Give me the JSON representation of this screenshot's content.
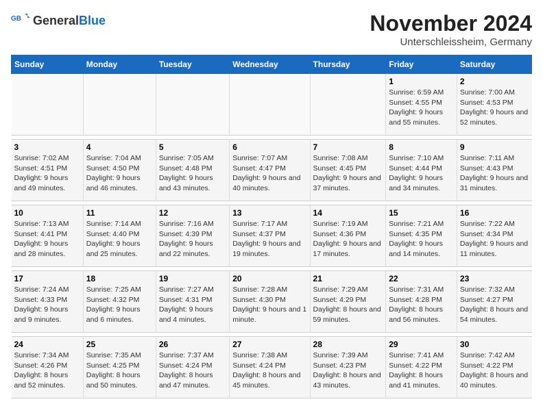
{
  "header": {
    "logo_general": "General",
    "logo_blue": "Blue",
    "title": "November 2024",
    "subtitle": "Unterschleissheim, Germany"
  },
  "weekdays": [
    "Sunday",
    "Monday",
    "Tuesday",
    "Wednesday",
    "Thursday",
    "Friday",
    "Saturday"
  ],
  "weeks": [
    {
      "days": [
        {
          "num": "",
          "sunrise": "",
          "sunset": "",
          "daylight": ""
        },
        {
          "num": "",
          "sunrise": "",
          "sunset": "",
          "daylight": ""
        },
        {
          "num": "",
          "sunrise": "",
          "sunset": "",
          "daylight": ""
        },
        {
          "num": "",
          "sunrise": "",
          "sunset": "",
          "daylight": ""
        },
        {
          "num": "",
          "sunrise": "",
          "sunset": "",
          "daylight": ""
        },
        {
          "num": "1",
          "sunrise": "Sunrise: 6:59 AM",
          "sunset": "Sunset: 4:55 PM",
          "daylight": "Daylight: 9 hours and 55 minutes."
        },
        {
          "num": "2",
          "sunrise": "Sunrise: 7:00 AM",
          "sunset": "Sunset: 4:53 PM",
          "daylight": "Daylight: 9 hours and 52 minutes."
        }
      ]
    },
    {
      "days": [
        {
          "num": "3",
          "sunrise": "Sunrise: 7:02 AM",
          "sunset": "Sunset: 4:51 PM",
          "daylight": "Daylight: 9 hours and 49 minutes."
        },
        {
          "num": "4",
          "sunrise": "Sunrise: 7:04 AM",
          "sunset": "Sunset: 4:50 PM",
          "daylight": "Daylight: 9 hours and 46 minutes."
        },
        {
          "num": "5",
          "sunrise": "Sunrise: 7:05 AM",
          "sunset": "Sunset: 4:48 PM",
          "daylight": "Daylight: 9 hours and 43 minutes."
        },
        {
          "num": "6",
          "sunrise": "Sunrise: 7:07 AM",
          "sunset": "Sunset: 4:47 PM",
          "daylight": "Daylight: 9 hours and 40 minutes."
        },
        {
          "num": "7",
          "sunrise": "Sunrise: 7:08 AM",
          "sunset": "Sunset: 4:45 PM",
          "daylight": "Daylight: 9 hours and 37 minutes."
        },
        {
          "num": "8",
          "sunrise": "Sunrise: 7:10 AM",
          "sunset": "Sunset: 4:44 PM",
          "daylight": "Daylight: 9 hours and 34 minutes."
        },
        {
          "num": "9",
          "sunrise": "Sunrise: 7:11 AM",
          "sunset": "Sunset: 4:43 PM",
          "daylight": "Daylight: 9 hours and 31 minutes."
        }
      ]
    },
    {
      "days": [
        {
          "num": "10",
          "sunrise": "Sunrise: 7:13 AM",
          "sunset": "Sunset: 4:41 PM",
          "daylight": "Daylight: 9 hours and 28 minutes."
        },
        {
          "num": "11",
          "sunrise": "Sunrise: 7:14 AM",
          "sunset": "Sunset: 4:40 PM",
          "daylight": "Daylight: 9 hours and 25 minutes."
        },
        {
          "num": "12",
          "sunrise": "Sunrise: 7:16 AM",
          "sunset": "Sunset: 4:39 PM",
          "daylight": "Daylight: 9 hours and 22 minutes."
        },
        {
          "num": "13",
          "sunrise": "Sunrise: 7:17 AM",
          "sunset": "Sunset: 4:37 PM",
          "daylight": "Daylight: 9 hours and 19 minutes."
        },
        {
          "num": "14",
          "sunrise": "Sunrise: 7:19 AM",
          "sunset": "Sunset: 4:36 PM",
          "daylight": "Daylight: 9 hours and 17 minutes."
        },
        {
          "num": "15",
          "sunrise": "Sunrise: 7:21 AM",
          "sunset": "Sunset: 4:35 PM",
          "daylight": "Daylight: 9 hours and 14 minutes."
        },
        {
          "num": "16",
          "sunrise": "Sunrise: 7:22 AM",
          "sunset": "Sunset: 4:34 PM",
          "daylight": "Daylight: 9 hours and 11 minutes."
        }
      ]
    },
    {
      "days": [
        {
          "num": "17",
          "sunrise": "Sunrise: 7:24 AM",
          "sunset": "Sunset: 4:33 PM",
          "daylight": "Daylight: 9 hours and 9 minutes."
        },
        {
          "num": "18",
          "sunrise": "Sunrise: 7:25 AM",
          "sunset": "Sunset: 4:32 PM",
          "daylight": "Daylight: 9 hours and 6 minutes."
        },
        {
          "num": "19",
          "sunrise": "Sunrise: 7:27 AM",
          "sunset": "Sunset: 4:31 PM",
          "daylight": "Daylight: 9 hours and 4 minutes."
        },
        {
          "num": "20",
          "sunrise": "Sunrise: 7:28 AM",
          "sunset": "Sunset: 4:30 PM",
          "daylight": "Daylight: 9 hours and 1 minute."
        },
        {
          "num": "21",
          "sunrise": "Sunrise: 7:29 AM",
          "sunset": "Sunset: 4:29 PM",
          "daylight": "Daylight: 8 hours and 59 minutes."
        },
        {
          "num": "22",
          "sunrise": "Sunrise: 7:31 AM",
          "sunset": "Sunset: 4:28 PM",
          "daylight": "Daylight: 8 hours and 56 minutes."
        },
        {
          "num": "23",
          "sunrise": "Sunrise: 7:32 AM",
          "sunset": "Sunset: 4:27 PM",
          "daylight": "Daylight: 8 hours and 54 minutes."
        }
      ]
    },
    {
      "days": [
        {
          "num": "24",
          "sunrise": "Sunrise: 7:34 AM",
          "sunset": "Sunset: 4:26 PM",
          "daylight": "Daylight: 8 hours and 52 minutes."
        },
        {
          "num": "25",
          "sunrise": "Sunrise: 7:35 AM",
          "sunset": "Sunset: 4:25 PM",
          "daylight": "Daylight: 8 hours and 50 minutes."
        },
        {
          "num": "26",
          "sunrise": "Sunrise: 7:37 AM",
          "sunset": "Sunset: 4:24 PM",
          "daylight": "Daylight: 8 hours and 47 minutes."
        },
        {
          "num": "27",
          "sunrise": "Sunrise: 7:38 AM",
          "sunset": "Sunset: 4:24 PM",
          "daylight": "Daylight: 8 hours and 45 minutes."
        },
        {
          "num": "28",
          "sunrise": "Sunrise: 7:39 AM",
          "sunset": "Sunset: 4:23 PM",
          "daylight": "Daylight: 8 hours and 43 minutes."
        },
        {
          "num": "29",
          "sunrise": "Sunrise: 7:41 AM",
          "sunset": "Sunset: 4:22 PM",
          "daylight": "Daylight: 8 hours and 41 minutes."
        },
        {
          "num": "30",
          "sunrise": "Sunrise: 7:42 AM",
          "sunset": "Sunset: 4:22 PM",
          "daylight": "Daylight: 8 hours and 40 minutes."
        }
      ]
    }
  ]
}
